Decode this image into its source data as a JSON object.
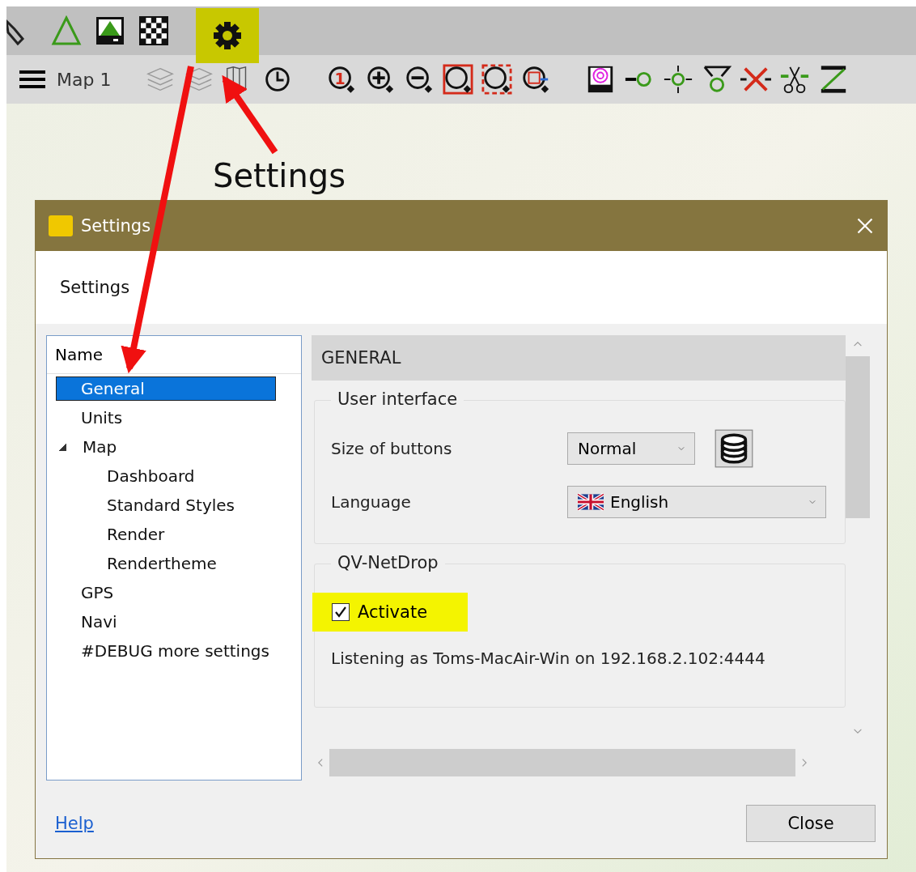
{
  "toolbar": {
    "map_label": "Map 1",
    "zoom_number": "1"
  },
  "annotation": {
    "label": "Settings"
  },
  "dialog": {
    "title": "Settings",
    "header": "Settings",
    "tree": {
      "column": "Name",
      "items": [
        {
          "label": "General",
          "selected": true
        },
        {
          "label": "Units",
          "selected": false
        },
        {
          "label": "Map",
          "selected": false,
          "expanded": true,
          "children": [
            {
              "label": "Dashboard",
              "selected": false
            },
            {
              "label": "Standard Styles",
              "selected": false
            },
            {
              "label": "Render",
              "selected": false
            },
            {
              "label": "Rendertheme",
              "selected": false
            }
          ]
        },
        {
          "label": "GPS",
          "selected": false
        },
        {
          "label": "Navi",
          "selected": false
        },
        {
          "label": "#DEBUG more settings",
          "selected": false
        }
      ]
    },
    "section": "GENERAL",
    "groups": [
      {
        "title": "User interface",
        "rows": [
          {
            "kind": "dropdown",
            "label": "Size of buttons",
            "value": "Normal"
          },
          {
            "kind": "language",
            "label": "Language",
            "value": "English"
          }
        ]
      },
      {
        "title": "QV-NetDrop",
        "rows": [
          {
            "kind": "checkbox",
            "label": "Activate",
            "checked": true
          },
          {
            "kind": "text",
            "text": "Listening as Toms-MacAir-Win on 192.168.2.102:4444"
          }
        ]
      }
    ],
    "help": "Help",
    "close": "Close"
  }
}
